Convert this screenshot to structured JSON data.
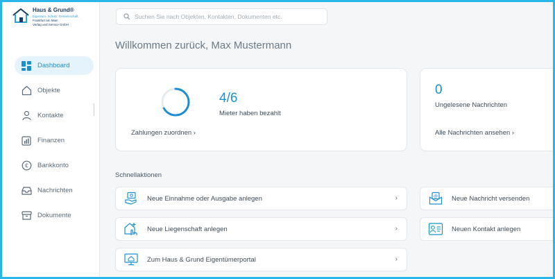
{
  "brand": {
    "title": "Haus & Grund®",
    "line1": "Eigentum. Schutz. Gemeinschaft.",
    "line2": "Frankfurt am Main",
    "line3": "Verlag und Service GmbH"
  },
  "sidebar": {
    "items": [
      {
        "label": "Dashboard",
        "icon": "dashboard-icon",
        "active": true
      },
      {
        "label": "Objekte",
        "icon": "house-icon"
      },
      {
        "label": "Kontakte",
        "icon": "person-icon"
      },
      {
        "label": "Finanzen",
        "icon": "chart-icon"
      },
      {
        "label": "Bankkonto",
        "icon": "euro-icon"
      },
      {
        "label": "Nachrichten",
        "icon": "inbox-icon"
      },
      {
        "label": "Dokumente",
        "icon": "archive-icon"
      }
    ]
  },
  "search": {
    "placeholder": "Suchen Sie nach Objekten, Kontakten, Dokumenten etc."
  },
  "welcome": "Willkommen zurück, Max Mustermann",
  "payments": {
    "ratio": "4/6",
    "label": "Mieter haben bezahlt",
    "progress": 0.67,
    "link": "Zahlungen zuordnen ›"
  },
  "messages": {
    "count": "0",
    "label": "Ungelesene Nachrichten",
    "link": "Alle Nachrichten ansehen ›"
  },
  "quick": {
    "title": "Schnellaktionen",
    "items": [
      {
        "label": "Neue Einnahme oder Ausgabe anlegen",
        "icon": "money-hand-icon"
      },
      {
        "label": "Neue Nachricht versenden",
        "icon": "mail-icon"
      },
      {
        "label": "Neue Liegenschaft anlegen",
        "icon": "add-house-icon"
      },
      {
        "label": "Neuen Kontakt anlegen",
        "icon": "contact-card-icon"
      },
      {
        "label": "Zum Haus & Grund Eigentümerportal",
        "icon": "portal-icon"
      }
    ],
    "chevron": "›"
  },
  "colors": {
    "accent": "#1c90cf",
    "frame": "#29b6e8",
    "active_bg": "#e5f4fc"
  }
}
